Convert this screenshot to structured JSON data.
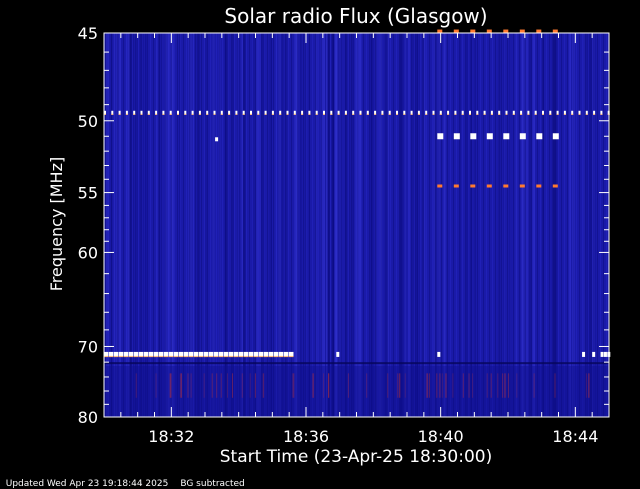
{
  "footer": {
    "updated": "Updated Wed Apr 23 19:18:44 2025",
    "note": "BG subtracted"
  },
  "colors": {
    "background": "#000000",
    "plot_blue": "#1a1aa8",
    "band_white": "#ffffff",
    "band_orange": "#ff7a30"
  },
  "chart_data": {
    "type": "heatmap",
    "title": "Solar radio Flux (Glasgow)",
    "xlabel": "Start Time (23-Apr-25 18:30:00)",
    "ylabel": "Frequency [MHz]",
    "x_range_minutes": [
      0,
      15
    ],
    "x_ticks": [
      {
        "label": "18:32",
        "minute": 2
      },
      {
        "label": "18:36",
        "minute": 6
      },
      {
        "label": "18:40",
        "minute": 10
      },
      {
        "label": "18:44",
        "minute": 14
      }
    ],
    "y_range_mhz": [
      45,
      80
    ],
    "y_scale": "reciprocal",
    "y_ticks": [
      45,
      50,
      55,
      60,
      70,
      80
    ],
    "colorscale": "blue-to-white",
    "features": [
      {
        "type": "intermittent-band",
        "freq_mhz": 49.5,
        "start_minute": 0,
        "end_minute": 15,
        "color": "white"
      },
      {
        "type": "intermittent-band",
        "freq_mhz": 71.0,
        "start_minute": 0,
        "end_minute": 5.5,
        "color": "white"
      },
      {
        "type": "intermittent-band",
        "freq_mhz": 44.9,
        "start_minute": 9.9,
        "end_minute": 13.5,
        "color": "orange"
      },
      {
        "type": "intermittent-band",
        "freq_mhz": 51.0,
        "start_minute": 9.9,
        "end_minute": 13.6,
        "color": "white"
      },
      {
        "type": "intermittent-band",
        "freq_mhz": 54.5,
        "start_minute": 9.9,
        "end_minute": 13.5,
        "color": "orange"
      }
    ]
  }
}
